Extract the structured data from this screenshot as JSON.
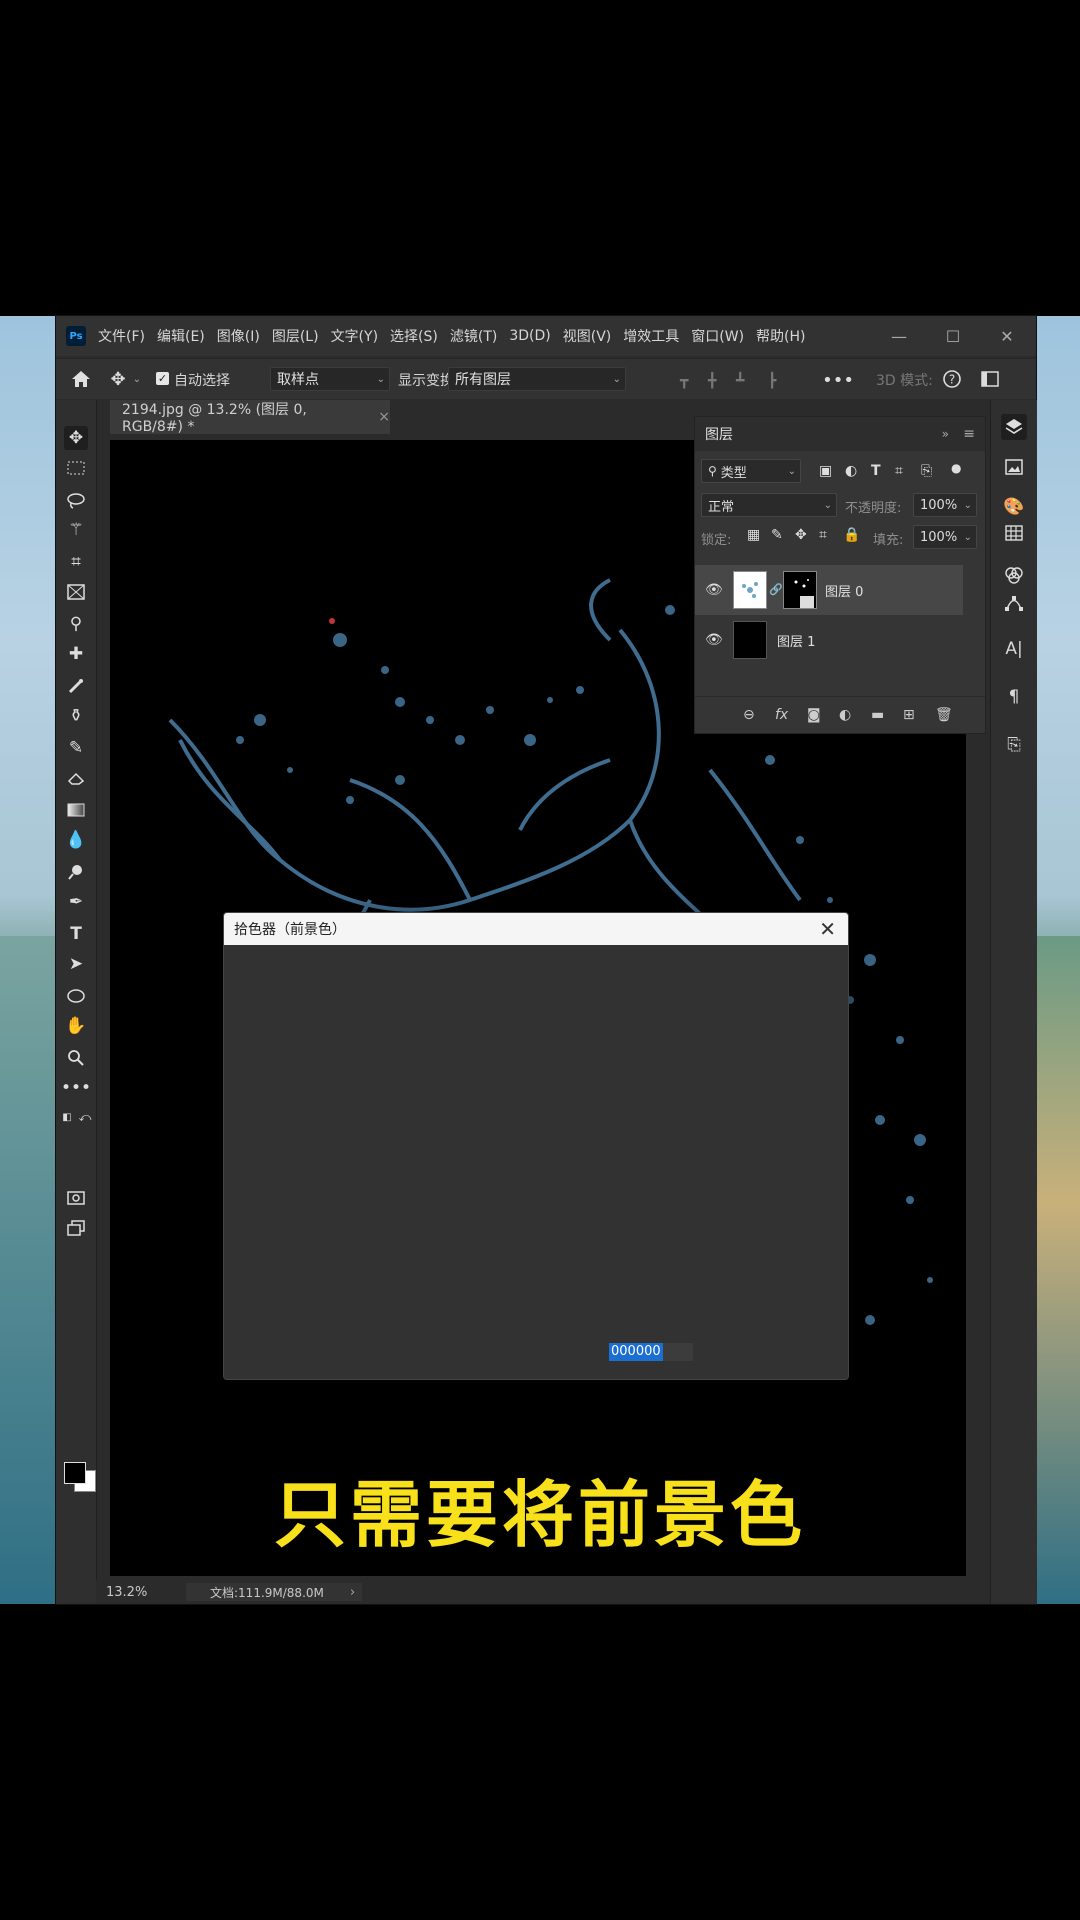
{
  "menubar": {
    "logo": "Ps",
    "items": [
      "文件(F)",
      "编辑(E)",
      "图像(I)",
      "图层(L)",
      "文字(Y)",
      "选择(S)",
      "滤镜(T)",
      "3D(D)",
      "视图(V)",
      "增效工具",
      "窗口(W)",
      "帮助(H)"
    ],
    "window_controls": [
      "—",
      "☐",
      "✕"
    ]
  },
  "options": {
    "auto_select_label": "自动选择",
    "auto_select_value": "取样点",
    "show_transform_label": "显示变换",
    "layers_select": "所有图层",
    "mode_3d": "3D 模式:"
  },
  "document": {
    "tab_title": "2194.jpg @ 13.2% (图层 0, RGB/8#) *",
    "close": "×"
  },
  "statusbar": {
    "zoom": "13.2%",
    "doc_info": "文档:111.9M/88.0M",
    "arrow": "›"
  },
  "layers_panel": {
    "title": "图层",
    "filter_type": "类型",
    "blend_mode": "正常",
    "opacity_label": "不透明度:",
    "opacity_value": "100%",
    "lock_label": "锁定:",
    "fill_label": "填充:",
    "fill_value": "100%",
    "layers": [
      {
        "name": "图层 0",
        "selected": true
      },
      {
        "name": "图层 1",
        "selected": false
      }
    ]
  },
  "color_picker": {
    "title": "拾色器（前景色）",
    "close": "✕",
    "hex_value": "000000"
  },
  "caption": "只需要将前景色",
  "colors": {
    "caption": "#f8e01a",
    "accent": "#1c6fd2",
    "water_splash": "#4a7fa8"
  }
}
